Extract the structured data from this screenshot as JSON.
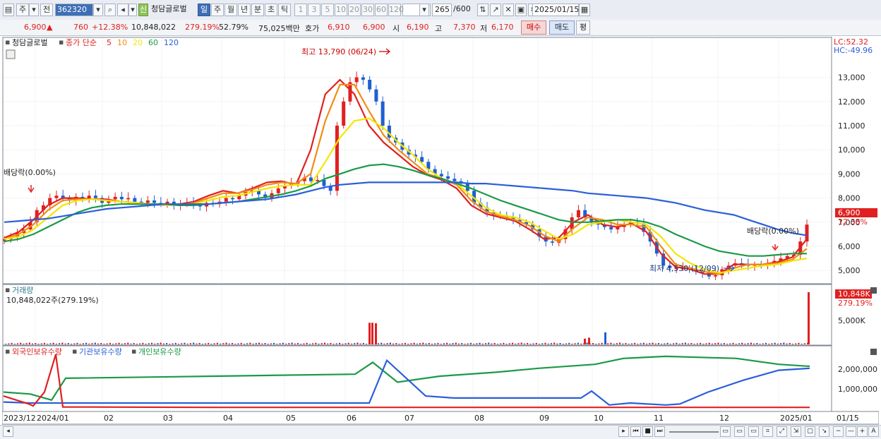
{
  "toolbar": {
    "market": "주",
    "prev_label": "전",
    "code": "362320",
    "stock_name": "청담글로벌",
    "new_badge": "신",
    "periods": [
      "일",
      "주",
      "월",
      "년",
      "분",
      "초",
      "틱"
    ],
    "active_period": "일",
    "minutes": [
      "1",
      "3",
      "5",
      "10",
      "20",
      "30",
      "60",
      "120"
    ],
    "count_value": "265",
    "count_total": "/600",
    "date": "2025/01/15"
  },
  "quote": {
    "price": "6,900",
    "up_arrow": "▲",
    "change": "760",
    "change_pct": "+12.38%",
    "volume": "10,848,022",
    "volume_ratio": "279.19%",
    "turnover": "52.79%",
    "amount": "75,025백만",
    "ask_label": "호가",
    "ask": "6,910",
    "bid": "6,900",
    "open_label": "시",
    "open": "6,190",
    "high_label": "고",
    "high": "7,370",
    "low_label": "저",
    "low": "6,170",
    "buy_label": "매수",
    "sell_label": "매도",
    "eval_label": "평"
  },
  "price_panel": {
    "title": "청담글로벌",
    "legend_prefix": "종가 단순",
    "ma_labels": [
      "5",
      "10",
      "20",
      "60",
      "120"
    ],
    "ma_colors": [
      "#e02020",
      "#f08c14",
      "#f5e600",
      "#1a9a46",
      "#2b5fd9"
    ],
    "lc_label": "LC:52.32",
    "hc_label": "HC:-49.96",
    "y_ticks": [
      "13,000",
      "12,000",
      "11,000",
      "10,000",
      "9,000",
      "8,000",
      "7,000",
      "6,000",
      "5,000"
    ],
    "price_badge": "6,900",
    "pct_badge": "12.38%",
    "dividend_left": "배당락(0.00%)",
    "dividend_right": "배당락(0.00%)",
    "high_note": "최고 13,790 (06/24)",
    "low_note": "최저 4,530 (12/09)"
  },
  "volume_panel": {
    "title": "거래량",
    "value_label": "10,848,022주(279.19%)",
    "y_tick": "5,000K",
    "badge": "10,848K",
    "badge_pct": "279.19%"
  },
  "holding_panel": {
    "series": [
      "외국인보유수량",
      "기관보유수량",
      "개인보유수량"
    ],
    "colors": [
      "#e02020",
      "#2b5fd9",
      "#1a9a46"
    ],
    "y_ticks": [
      "2,000,000",
      "1,000,000"
    ]
  },
  "x_axis": {
    "labels": [
      "2023/12",
      "2024/01",
      "02",
      "03",
      "04",
      "05",
      "06",
      "07",
      "08",
      "09",
      "10",
      "11",
      "12",
      "2025/01"
    ],
    "right_label": "01/15"
  },
  "chart_data": {
    "type": "candlestick",
    "period": "daily",
    "price_high": {
      "value": 13790,
      "date": "06/24"
    },
    "price_low": {
      "value": 4530,
      "date": "12/09"
    },
    "last": {
      "open": 6190,
      "high": 7370,
      "low": 6170,
      "close": 6900
    },
    "close_series": [
      6300,
      6400,
      6550,
      6700,
      7000,
      7500,
      7700,
      8000,
      8100,
      8000,
      7900,
      8050,
      7950,
      8100,
      8000,
      7800,
      7950,
      8050,
      7950,
      8000,
      7850,
      7800,
      7900,
      7800,
      7750,
      7850,
      7700,
      7750,
      7800,
      7700,
      7650,
      7800,
      7750,
      7850,
      8000,
      7950,
      8100,
      8250,
      8300,
      8150,
      8000,
      8200,
      8400,
      8500,
      8600,
      8700,
      8850,
      8700,
      8750,
      8500,
      8300,
      11000,
      12000,
      12800,
      13000,
      12900,
      12500,
      12000,
      11000,
      10500,
      10300,
      10000,
      9800,
      9700,
      9500,
      9200,
      9000,
      8900,
      8800,
      8700,
      8600,
      8300,
      7800,
      7600,
      7400,
      7300,
      7250,
      7200,
      7100,
      7000,
      6900,
      6700,
      6400,
      6200,
      6150,
      6300,
      6700,
      7200,
      7500,
      7200,
      7000,
      6900,
      6800,
      6700,
      6800,
      6900,
      7000,
      6950,
      6600,
      6200,
      5700,
      5200,
      5100,
      5100,
      5100,
      5050,
      5000,
      4900,
      4750,
      4800,
      5050,
      5200,
      5300,
      5250,
      5200,
      5250,
      5200,
      5300,
      5400,
      5500,
      5600,
      5650,
      6200,
      6900
    ],
    "ma_series": [
      {
        "name": "5",
        "values": [
          6350,
          6600,
          7100,
          7700,
          8000,
          8000,
          7950,
          7950,
          7850,
          7800,
          7750,
          7700,
          7750,
          7850,
          8100,
          8300,
          8200,
          8400,
          8650,
          8700,
          8550,
          10000,
          12300,
          12900,
          12300,
          11000,
          10300,
          9800,
          9300,
          8950,
          8750,
          8400,
          7700,
          7350,
          7200,
          7050,
          6700,
          6300,
          6350,
          7000,
          7300,
          6900,
          6800,
          6950,
          6600,
          5700,
          5150,
          5050,
          4850,
          4850,
          5250,
          5250,
          5250,
          5350,
          5550,
          6300
        ]
      },
      {
        "name": "10",
        "values": [
          6300,
          6500,
          6900,
          7500,
          7900,
          7950,
          7950,
          7900,
          7850,
          7800,
          7750,
          7700,
          7700,
          7800,
          8000,
          8200,
          8200,
          8350,
          8550,
          8650,
          8600,
          9000,
          11200,
          12700,
          12700,
          11600,
          10600,
          10000,
          9500,
          9000,
          8800,
          8550,
          7900,
          7450,
          7250,
          7100,
          6850,
          6450,
          6200,
          6750,
          7200,
          7100,
          6900,
          6900,
          6800,
          6000,
          5250,
          5100,
          4950,
          4850,
          5100,
          5250,
          5250,
          5300,
          5450,
          5900
        ]
      },
      {
        "name": "20",
        "values": [
          6300,
          6400,
          6700,
          7200,
          7700,
          7900,
          7950,
          7900,
          7850,
          7800,
          7750,
          7700,
          7700,
          7750,
          7900,
          8050,
          8100,
          8250,
          8400,
          8500,
          8550,
          8550,
          9500,
          10500,
          11200,
          11300,
          10900,
          10300,
          9800,
          9200,
          8800,
          8600,
          8100,
          7600,
          7300,
          7200,
          7000,
          6650,
          6300,
          6500,
          6900,
          7000,
          7100,
          7000,
          6900,
          6400,
          5700,
          5300,
          5050,
          4900,
          5000,
          5100,
          5200,
          5250,
          5400,
          5500
        ]
      },
      {
        "name": "60",
        "values": [
          6200,
          6300,
          6500,
          6800,
          7100,
          7400,
          7600,
          7700,
          7750,
          7750,
          7750,
          7750,
          7700,
          7700,
          7750,
          7800,
          7850,
          7950,
          8050,
          8150,
          8300,
          8500,
          8800,
          9000,
          9200,
          9350,
          9400,
          9300,
          9150,
          8950,
          8800,
          8600,
          8400,
          8150,
          7900,
          7700,
          7500,
          7300,
          7100,
          7000,
          7000,
          7050,
          7100,
          7100,
          7000,
          6800,
          6500,
          6250,
          6000,
          5800,
          5700,
          5600,
          5600,
          5650,
          5700,
          5700
        ]
      },
      {
        "name": "120",
        "values": [
          7000,
          7050,
          7100,
          7150,
          7250,
          7350,
          7450,
          7550,
          7600,
          7650,
          7700,
          7750,
          7750,
          7750,
          7750,
          7800,
          7850,
          7900,
          7950,
          8050,
          8150,
          8300,
          8450,
          8550,
          8600,
          8650,
          8650,
          8650,
          8650,
          8650,
          8650,
          8650,
          8600,
          8600,
          8550,
          8500,
          8450,
          8400,
          8350,
          8300,
          8200,
          8150,
          8100,
          8050,
          8000,
          7900,
          7800,
          7650,
          7500,
          7400,
          7300,
          7100,
          6900,
          6700,
          6550,
          6450
        ]
      }
    ],
    "volume_spikes": [
      {
        "date": "06/18",
        "value": 4500
      },
      {
        "date": "06/20",
        "value": 4500
      },
      {
        "date": "06/21",
        "value": 4400
      },
      {
        "date": "09/27",
        "value": 1200
      },
      {
        "date": "09/30",
        "value": 1400
      },
      {
        "date": "10/02",
        "value": 2500
      },
      {
        "date": "2025/01/15",
        "value": 10848
      }
    ],
    "holdings": {
      "foreign": [
        600000,
        400000,
        200000,
        100000,
        800000,
        2700000,
        50000,
        30000,
        30000,
        30000
      ],
      "institution": [
        300000,
        250000,
        250000,
        250000,
        250000,
        250000,
        2400000,
        600000,
        500000,
        500000,
        850000,
        150000,
        250000,
        150000,
        200000,
        800000,
        1400000,
        1900000,
        2000000
      ],
      "individual": [
        800000,
        700000,
        400000,
        1500000,
        1600000,
        1700000,
        2300000,
        1300000,
        1600000,
        1800000,
        2000000,
        2200000,
        2500000,
        2600000,
        2500000,
        2200000,
        2100000
      ]
    }
  }
}
